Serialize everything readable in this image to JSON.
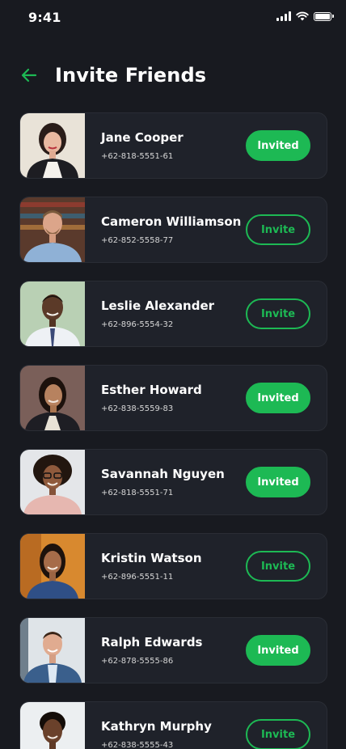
{
  "status_bar": {
    "time": "9:41"
  },
  "header": {
    "title": "Invite Friends"
  },
  "colors": {
    "accent": "#1db954",
    "background": "#181a20",
    "card": "#1f222a"
  },
  "friends": [
    {
      "name": "Jane Cooper",
      "phone": "+62-818-5551-61",
      "button_label": "Invited",
      "state": "invited"
    },
    {
      "name": "Cameron Williamson",
      "phone": "+62-852-5558-77",
      "button_label": "Invite",
      "state": "invite"
    },
    {
      "name": "Leslie Alexander",
      "phone": "+62-896-5554-32",
      "button_label": "Invite",
      "state": "invite"
    },
    {
      "name": "Esther Howard",
      "phone": "+62-838-5559-83",
      "button_label": "Invited",
      "state": "invited"
    },
    {
      "name": "Savannah Nguyen",
      "phone": "+62-818-5551-71",
      "button_label": "Invited",
      "state": "invited"
    },
    {
      "name": "Kristin Watson",
      "phone": "+62-896-5551-11",
      "button_label": "Invite",
      "state": "invite"
    },
    {
      "name": "Ralph Edwards",
      "phone": "+62-878-5555-86",
      "button_label": "Invited",
      "state": "invited"
    },
    {
      "name": "Kathryn Murphy",
      "phone": "+62-838-5555-43",
      "button_label": "Invite",
      "state": "invite"
    }
  ]
}
